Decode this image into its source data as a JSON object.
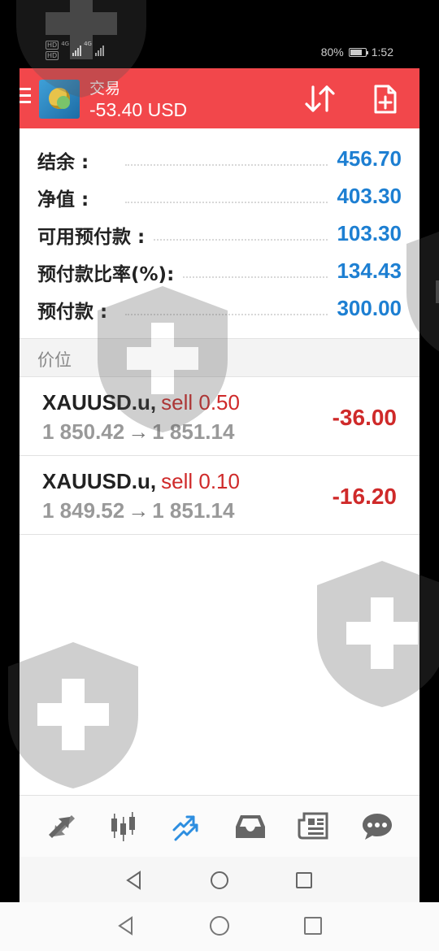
{
  "status_bar": {
    "battery": "80%",
    "battery_level": 0.8,
    "time": "1:52",
    "hd1": "HD",
    "hd2": "HD",
    "net1": "4G",
    "net2": "4G"
  },
  "header": {
    "title": "交易",
    "profit": "-53.40 USD",
    "icons": [
      "menu-icon",
      "app-logo",
      "sort-icon",
      "new-order-icon"
    ]
  },
  "summary": [
    {
      "label": "结余 :",
      "value": "456.70"
    },
    {
      "label": "净值 :",
      "value": "403.30"
    },
    {
      "label": "可用预付款 :",
      "value": "103.30"
    },
    {
      "label": "预付款比率(%):",
      "value": "134.43"
    },
    {
      "label": "预付款 :",
      "value": "300.00"
    }
  ],
  "positions_header": "价位",
  "positions": [
    {
      "symbol": "XAUUSD.u,",
      "type": "sell 0.50",
      "open": "1 850.42",
      "arrow": "→",
      "current": "1 851.14",
      "profit": "-36.00"
    },
    {
      "symbol": "XAUUSD.u,",
      "type": "sell 0.10",
      "open": "1 849.52",
      "arrow": "→",
      "current": "1 851.14",
      "profit": "-16.20"
    }
  ],
  "tabs": [
    {
      "icon": "quotes-icon",
      "active": false
    },
    {
      "icon": "chart-icon",
      "active": false
    },
    {
      "icon": "trade-icon",
      "active": true
    },
    {
      "icon": "history-icon",
      "active": false
    },
    {
      "icon": "news-icon",
      "active": false
    },
    {
      "icon": "messages-icon",
      "active": false
    }
  ],
  "colors": {
    "header_red": "#f2474b",
    "value_blue": "#1d7fd2",
    "loss_red": "#cf2a2a",
    "active_tab_blue": "#2d8ee0"
  }
}
